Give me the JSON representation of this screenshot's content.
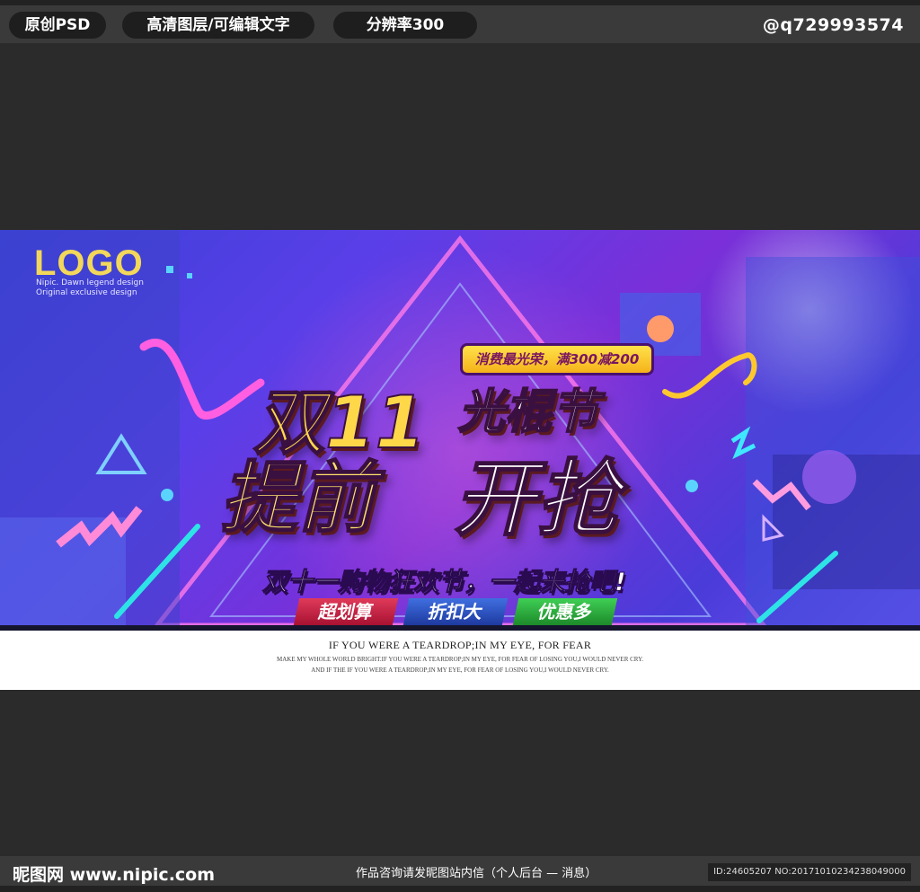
{
  "topbar": {
    "pills": [
      "原创PSD",
      "高清图层/可编辑文字",
      "分辨率300"
    ],
    "handle": "@q729993574"
  },
  "banner": {
    "logo": "LOGO",
    "logo_sub_1": "Nipic. Dawn legend design",
    "logo_sub_2": "Original exclusive design",
    "badge": "消费最光荣，满300减200",
    "title_1": "双11",
    "title_2": "光棍节",
    "title_3": "提前",
    "title_4": "开抢",
    "subtitle": "双十一购物狂欢节，一起来抢吧!",
    "tags": [
      "超划算",
      "折扣大",
      "优惠多"
    ],
    "caption_1": "IF YOU WERE A TEARDROP;IN MY EYE,  FOR FEAR",
    "caption_2": "MAKE MY WHOLE WORLD BRIGHT.IF YOU WERE A TEARDROP;IN MY EYE,  FOR FEAR OF LOSING YOU,I WOULD NEVER CRY.",
    "caption_3": "AND IF THE IF YOU WERE A TEARDROP;IN MY EYE,  FOR FEAR OF LOSING YOU,I WOULD NEVER CRY."
  },
  "bottombar": {
    "site": "昵图网 www.nipic.com",
    "notice": "作品咨询请发昵图站内信（个人后台 — 消息）",
    "id": "ID:24605207 NO:20171010234238049000"
  },
  "colors": {
    "background": "#2b2b2b",
    "bar": "#3a3a3a",
    "gold": "#ffd84a",
    "purple": "#5a3fe8"
  }
}
